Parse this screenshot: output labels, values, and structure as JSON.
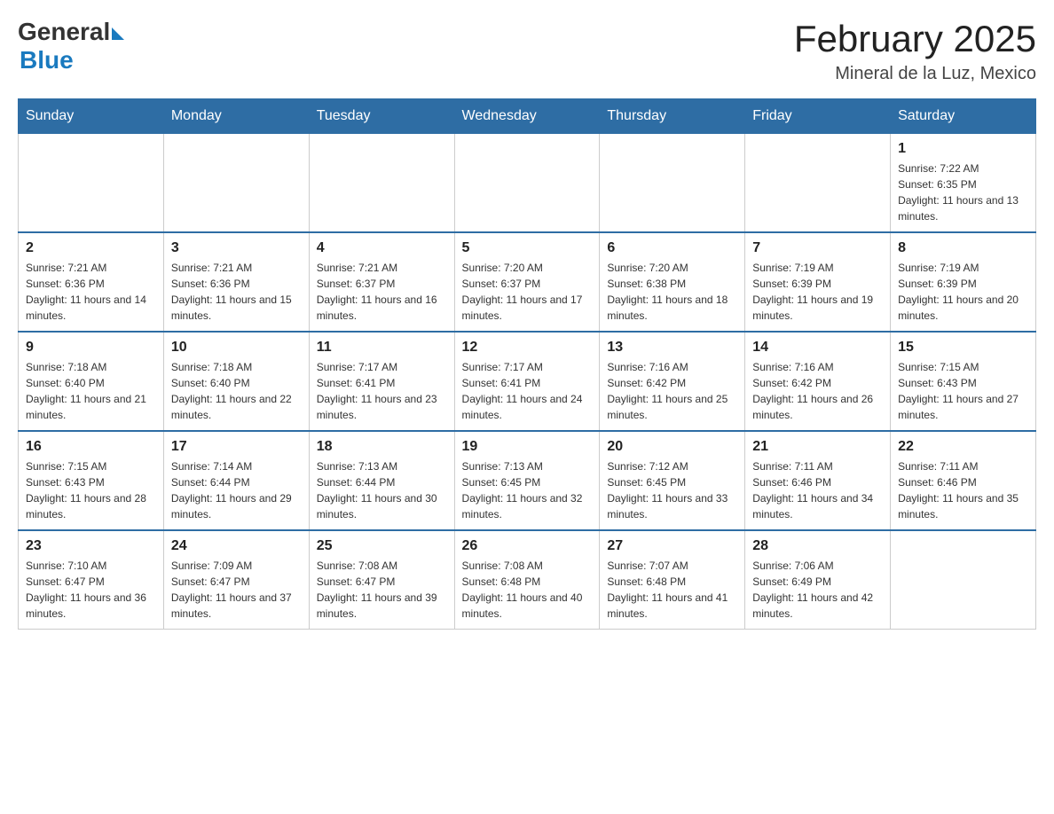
{
  "header": {
    "logo_general": "General",
    "logo_blue": "Blue",
    "month_title": "February 2025",
    "location": "Mineral de la Luz, Mexico"
  },
  "days_of_week": [
    "Sunday",
    "Monday",
    "Tuesday",
    "Wednesday",
    "Thursday",
    "Friday",
    "Saturday"
  ],
  "weeks": [
    [
      {
        "day": "",
        "info": ""
      },
      {
        "day": "",
        "info": ""
      },
      {
        "day": "",
        "info": ""
      },
      {
        "day": "",
        "info": ""
      },
      {
        "day": "",
        "info": ""
      },
      {
        "day": "",
        "info": ""
      },
      {
        "day": "1",
        "info": "Sunrise: 7:22 AM\nSunset: 6:35 PM\nDaylight: 11 hours and 13 minutes."
      }
    ],
    [
      {
        "day": "2",
        "info": "Sunrise: 7:21 AM\nSunset: 6:36 PM\nDaylight: 11 hours and 14 minutes."
      },
      {
        "day": "3",
        "info": "Sunrise: 7:21 AM\nSunset: 6:36 PM\nDaylight: 11 hours and 15 minutes."
      },
      {
        "day": "4",
        "info": "Sunrise: 7:21 AM\nSunset: 6:37 PM\nDaylight: 11 hours and 16 minutes."
      },
      {
        "day": "5",
        "info": "Sunrise: 7:20 AM\nSunset: 6:37 PM\nDaylight: 11 hours and 17 minutes."
      },
      {
        "day": "6",
        "info": "Sunrise: 7:20 AM\nSunset: 6:38 PM\nDaylight: 11 hours and 18 minutes."
      },
      {
        "day": "7",
        "info": "Sunrise: 7:19 AM\nSunset: 6:39 PM\nDaylight: 11 hours and 19 minutes."
      },
      {
        "day": "8",
        "info": "Sunrise: 7:19 AM\nSunset: 6:39 PM\nDaylight: 11 hours and 20 minutes."
      }
    ],
    [
      {
        "day": "9",
        "info": "Sunrise: 7:18 AM\nSunset: 6:40 PM\nDaylight: 11 hours and 21 minutes."
      },
      {
        "day": "10",
        "info": "Sunrise: 7:18 AM\nSunset: 6:40 PM\nDaylight: 11 hours and 22 minutes."
      },
      {
        "day": "11",
        "info": "Sunrise: 7:17 AM\nSunset: 6:41 PM\nDaylight: 11 hours and 23 minutes."
      },
      {
        "day": "12",
        "info": "Sunrise: 7:17 AM\nSunset: 6:41 PM\nDaylight: 11 hours and 24 minutes."
      },
      {
        "day": "13",
        "info": "Sunrise: 7:16 AM\nSunset: 6:42 PM\nDaylight: 11 hours and 25 minutes."
      },
      {
        "day": "14",
        "info": "Sunrise: 7:16 AM\nSunset: 6:42 PM\nDaylight: 11 hours and 26 minutes."
      },
      {
        "day": "15",
        "info": "Sunrise: 7:15 AM\nSunset: 6:43 PM\nDaylight: 11 hours and 27 minutes."
      }
    ],
    [
      {
        "day": "16",
        "info": "Sunrise: 7:15 AM\nSunset: 6:43 PM\nDaylight: 11 hours and 28 minutes."
      },
      {
        "day": "17",
        "info": "Sunrise: 7:14 AM\nSunset: 6:44 PM\nDaylight: 11 hours and 29 minutes."
      },
      {
        "day": "18",
        "info": "Sunrise: 7:13 AM\nSunset: 6:44 PM\nDaylight: 11 hours and 30 minutes."
      },
      {
        "day": "19",
        "info": "Sunrise: 7:13 AM\nSunset: 6:45 PM\nDaylight: 11 hours and 32 minutes."
      },
      {
        "day": "20",
        "info": "Sunrise: 7:12 AM\nSunset: 6:45 PM\nDaylight: 11 hours and 33 minutes."
      },
      {
        "day": "21",
        "info": "Sunrise: 7:11 AM\nSunset: 6:46 PM\nDaylight: 11 hours and 34 minutes."
      },
      {
        "day": "22",
        "info": "Sunrise: 7:11 AM\nSunset: 6:46 PM\nDaylight: 11 hours and 35 minutes."
      }
    ],
    [
      {
        "day": "23",
        "info": "Sunrise: 7:10 AM\nSunset: 6:47 PM\nDaylight: 11 hours and 36 minutes."
      },
      {
        "day": "24",
        "info": "Sunrise: 7:09 AM\nSunset: 6:47 PM\nDaylight: 11 hours and 37 minutes."
      },
      {
        "day": "25",
        "info": "Sunrise: 7:08 AM\nSunset: 6:47 PM\nDaylight: 11 hours and 39 minutes."
      },
      {
        "day": "26",
        "info": "Sunrise: 7:08 AM\nSunset: 6:48 PM\nDaylight: 11 hours and 40 minutes."
      },
      {
        "day": "27",
        "info": "Sunrise: 7:07 AM\nSunset: 6:48 PM\nDaylight: 11 hours and 41 minutes."
      },
      {
        "day": "28",
        "info": "Sunrise: 7:06 AM\nSunset: 6:49 PM\nDaylight: 11 hours and 42 minutes."
      },
      {
        "day": "",
        "info": ""
      }
    ]
  ]
}
